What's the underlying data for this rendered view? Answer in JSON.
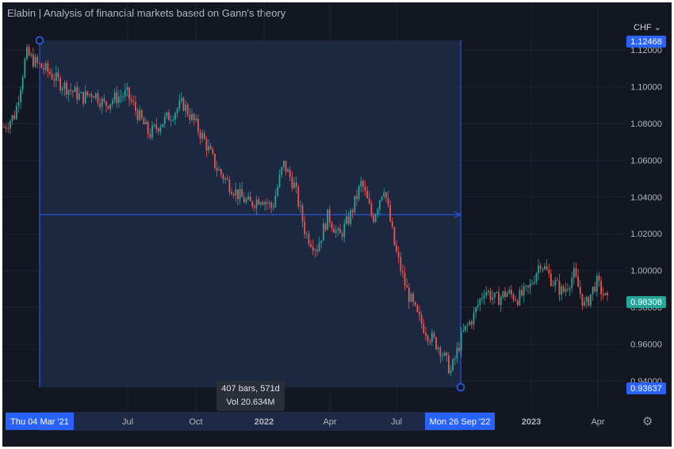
{
  "title": "Elabin | Analysis of financial markets based on Gann's theory",
  "currency": "CHF",
  "tooltip": {
    "bars": "407 bars, 571d",
    "vol": "Vol 20.634M"
  },
  "colors": {
    "up": "#26a69a",
    "down": "#ef5350",
    "range_line": "#2962ff",
    "range_fill": "#1e2a45",
    "background": "#131722"
  },
  "icons": {
    "currency_dropdown": "chevron-down-icon",
    "settings": "gear-icon"
  },
  "chart_data": {
    "type": "candlestick",
    "y_axis": {
      "ticks": [
        "1.12000",
        "1.10000",
        "1.08000",
        "1.06000",
        "1.04000",
        "1.02000",
        "1.00000",
        "0.98000",
        "0.96000",
        "0.94000"
      ],
      "tick_values": [
        1.12,
        1.1,
        1.08,
        1.06,
        1.04,
        1.02,
        1.0,
        0.98,
        0.96,
        0.94
      ],
      "range": [
        0.93,
        1.135
      ]
    },
    "x_axis": {
      "labels": [
        "Jul",
        "Oct",
        "2022",
        "Apr",
        "Jul",
        "2023",
        "Apr"
      ],
      "bold": [
        false,
        false,
        true,
        false,
        false,
        true,
        false
      ]
    },
    "badges": {
      "range_high": "1.12468",
      "current": "0.98308",
      "range_low": "0.93637",
      "start_date": "Thu 04 Mar '21",
      "end_date": "Mon 26 Sep '22"
    },
    "range": {
      "start_price": 1.12468,
      "end_price": 0.93637,
      "bars": 407,
      "days": 571,
      "volume": "20.634M"
    },
    "series": [
      {
        "x": "2021-01",
        "close": 1.078
      },
      {
        "x": "2021-02",
        "close": 1.085
      },
      {
        "x": "2021-03",
        "close": 1.118
      },
      {
        "x": "2021-03b",
        "close": 1.112
      },
      {
        "x": "2021-04",
        "close": 1.108
      },
      {
        "x": "2021-04b",
        "close": 1.102
      },
      {
        "x": "2021-05",
        "close": 1.098
      },
      {
        "x": "2021-05b",
        "close": 1.094
      },
      {
        "x": "2021-06",
        "close": 1.097
      },
      {
        "x": "2021-06b",
        "close": 1.09
      },
      {
        "x": "2021-07",
        "close": 1.094
      },
      {
        "x": "2021-07b",
        "close": 1.096
      },
      {
        "x": "2021-08",
        "close": 1.085
      },
      {
        "x": "2021-08b",
        "close": 1.074
      },
      {
        "x": "2021-09",
        "close": 1.08
      },
      {
        "x": "2021-09b",
        "close": 1.085
      },
      {
        "x": "2021-10",
        "close": 1.091
      },
      {
        "x": "2021-10b",
        "close": 1.081
      },
      {
        "x": "2021-11",
        "close": 1.07
      },
      {
        "x": "2021-11b",
        "close": 1.056
      },
      {
        "x": "2021-12",
        "close": 1.048
      },
      {
        "x": "2021-12b",
        "close": 1.041
      },
      {
        "x": "2022-01",
        "close": 1.036
      },
      {
        "x": "2022-01b",
        "close": 1.04
      },
      {
        "x": "2022-02",
        "close": 1.034
      },
      {
        "x": "2022-02b",
        "close": 1.058
      },
      {
        "x": "2022-03",
        "close": 1.046
      },
      {
        "x": "2022-03b",
        "close": 1.02
      },
      {
        "x": "2022-04",
        "close": 1.012
      },
      {
        "x": "2022-04b",
        "close": 1.03
      },
      {
        "x": "2022-05",
        "close": 1.018
      },
      {
        "x": "2022-05b",
        "close": 1.03
      },
      {
        "x": "2022-06",
        "close": 1.048
      },
      {
        "x": "2022-06b",
        "close": 1.028
      },
      {
        "x": "2022-06c",
        "close": 1.046
      },
      {
        "x": "2022-07",
        "close": 1.012
      },
      {
        "x": "2022-07b",
        "close": 0.99
      },
      {
        "x": "2022-08",
        "close": 0.975
      },
      {
        "x": "2022-08b",
        "close": 0.965
      },
      {
        "x": "2022-09",
        "close": 0.958
      },
      {
        "x": "2022-09b",
        "close": 0.945
      },
      {
        "x": "2022-10",
        "close": 0.965
      },
      {
        "x": "2022-10b",
        "close": 0.975
      },
      {
        "x": "2022-11",
        "close": 0.99
      },
      {
        "x": "2022-11b",
        "close": 0.984
      },
      {
        "x": "2022-12",
        "close": 0.988
      },
      {
        "x": "2022-12b",
        "close": 0.985
      },
      {
        "x": "2023-01",
        "close": 0.99
      },
      {
        "x": "2023-01b",
        "close": 1.005
      },
      {
        "x": "2023-02",
        "close": 0.995
      },
      {
        "x": "2023-02b",
        "close": 0.988
      },
      {
        "x": "2023-03",
        "close": 0.998
      },
      {
        "x": "2023-03b",
        "close": 0.98
      },
      {
        "x": "2023-04",
        "close": 0.994
      },
      {
        "x": "2023-04b",
        "close": 0.983
      }
    ]
  }
}
